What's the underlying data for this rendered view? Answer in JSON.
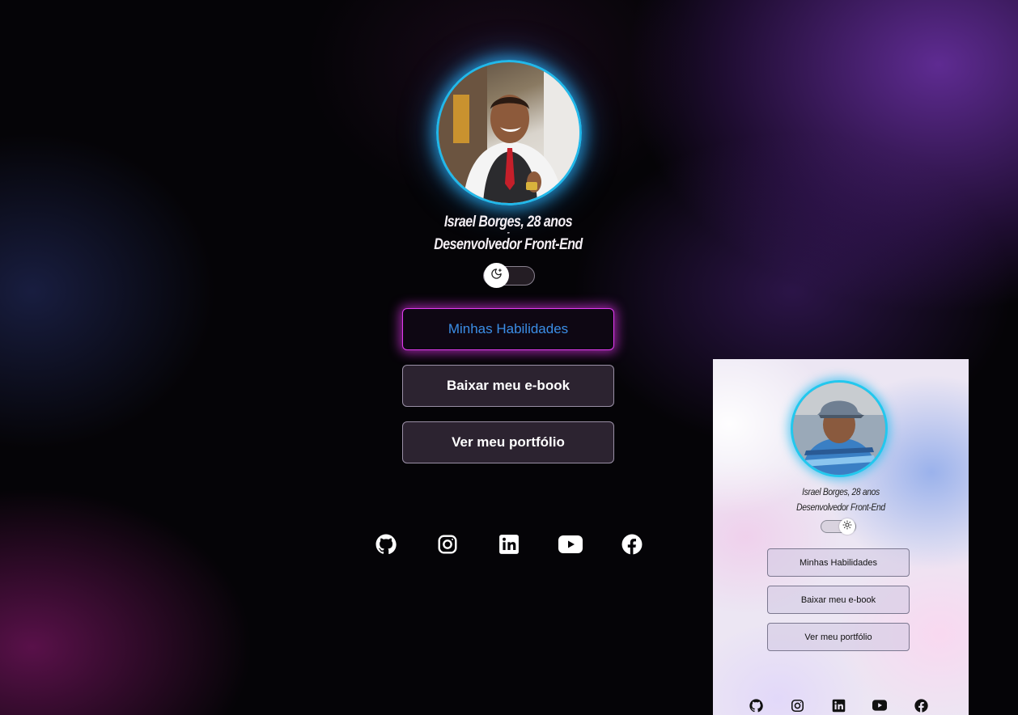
{
  "profile": {
    "name_line": "Israel Borges, 28 anos",
    "separator": "-",
    "role_line": "Desenvolvedor Front-End"
  },
  "theme_toggle": {
    "mode": "dark",
    "icon": "moon-icon"
  },
  "buttons": [
    {
      "label": "Minhas Habilidades",
      "highlighted": true
    },
    {
      "label": "Baixar meu e-book"
    },
    {
      "label": "Ver meu portfólio"
    }
  ],
  "social_icons": [
    "github-icon",
    "instagram-icon",
    "linkedin-icon",
    "youtube-icon",
    "facebook-icon"
  ],
  "preview": {
    "name_line": "Israel Borges, 28 anos",
    "role_line": "Desenvolvedor Front-End",
    "theme_toggle": {
      "mode": "light",
      "icon": "sun-icon"
    },
    "buttons": [
      {
        "label": "Minhas Habilidades"
      },
      {
        "label": "Baixar meu e-book"
      },
      {
        "label": "Ver meu portfólio"
      }
    ]
  },
  "colors": {
    "avatar_ring": "#22b8ea",
    "highlight_border": "#e23cf0",
    "highlight_text": "#3b8ee6"
  }
}
